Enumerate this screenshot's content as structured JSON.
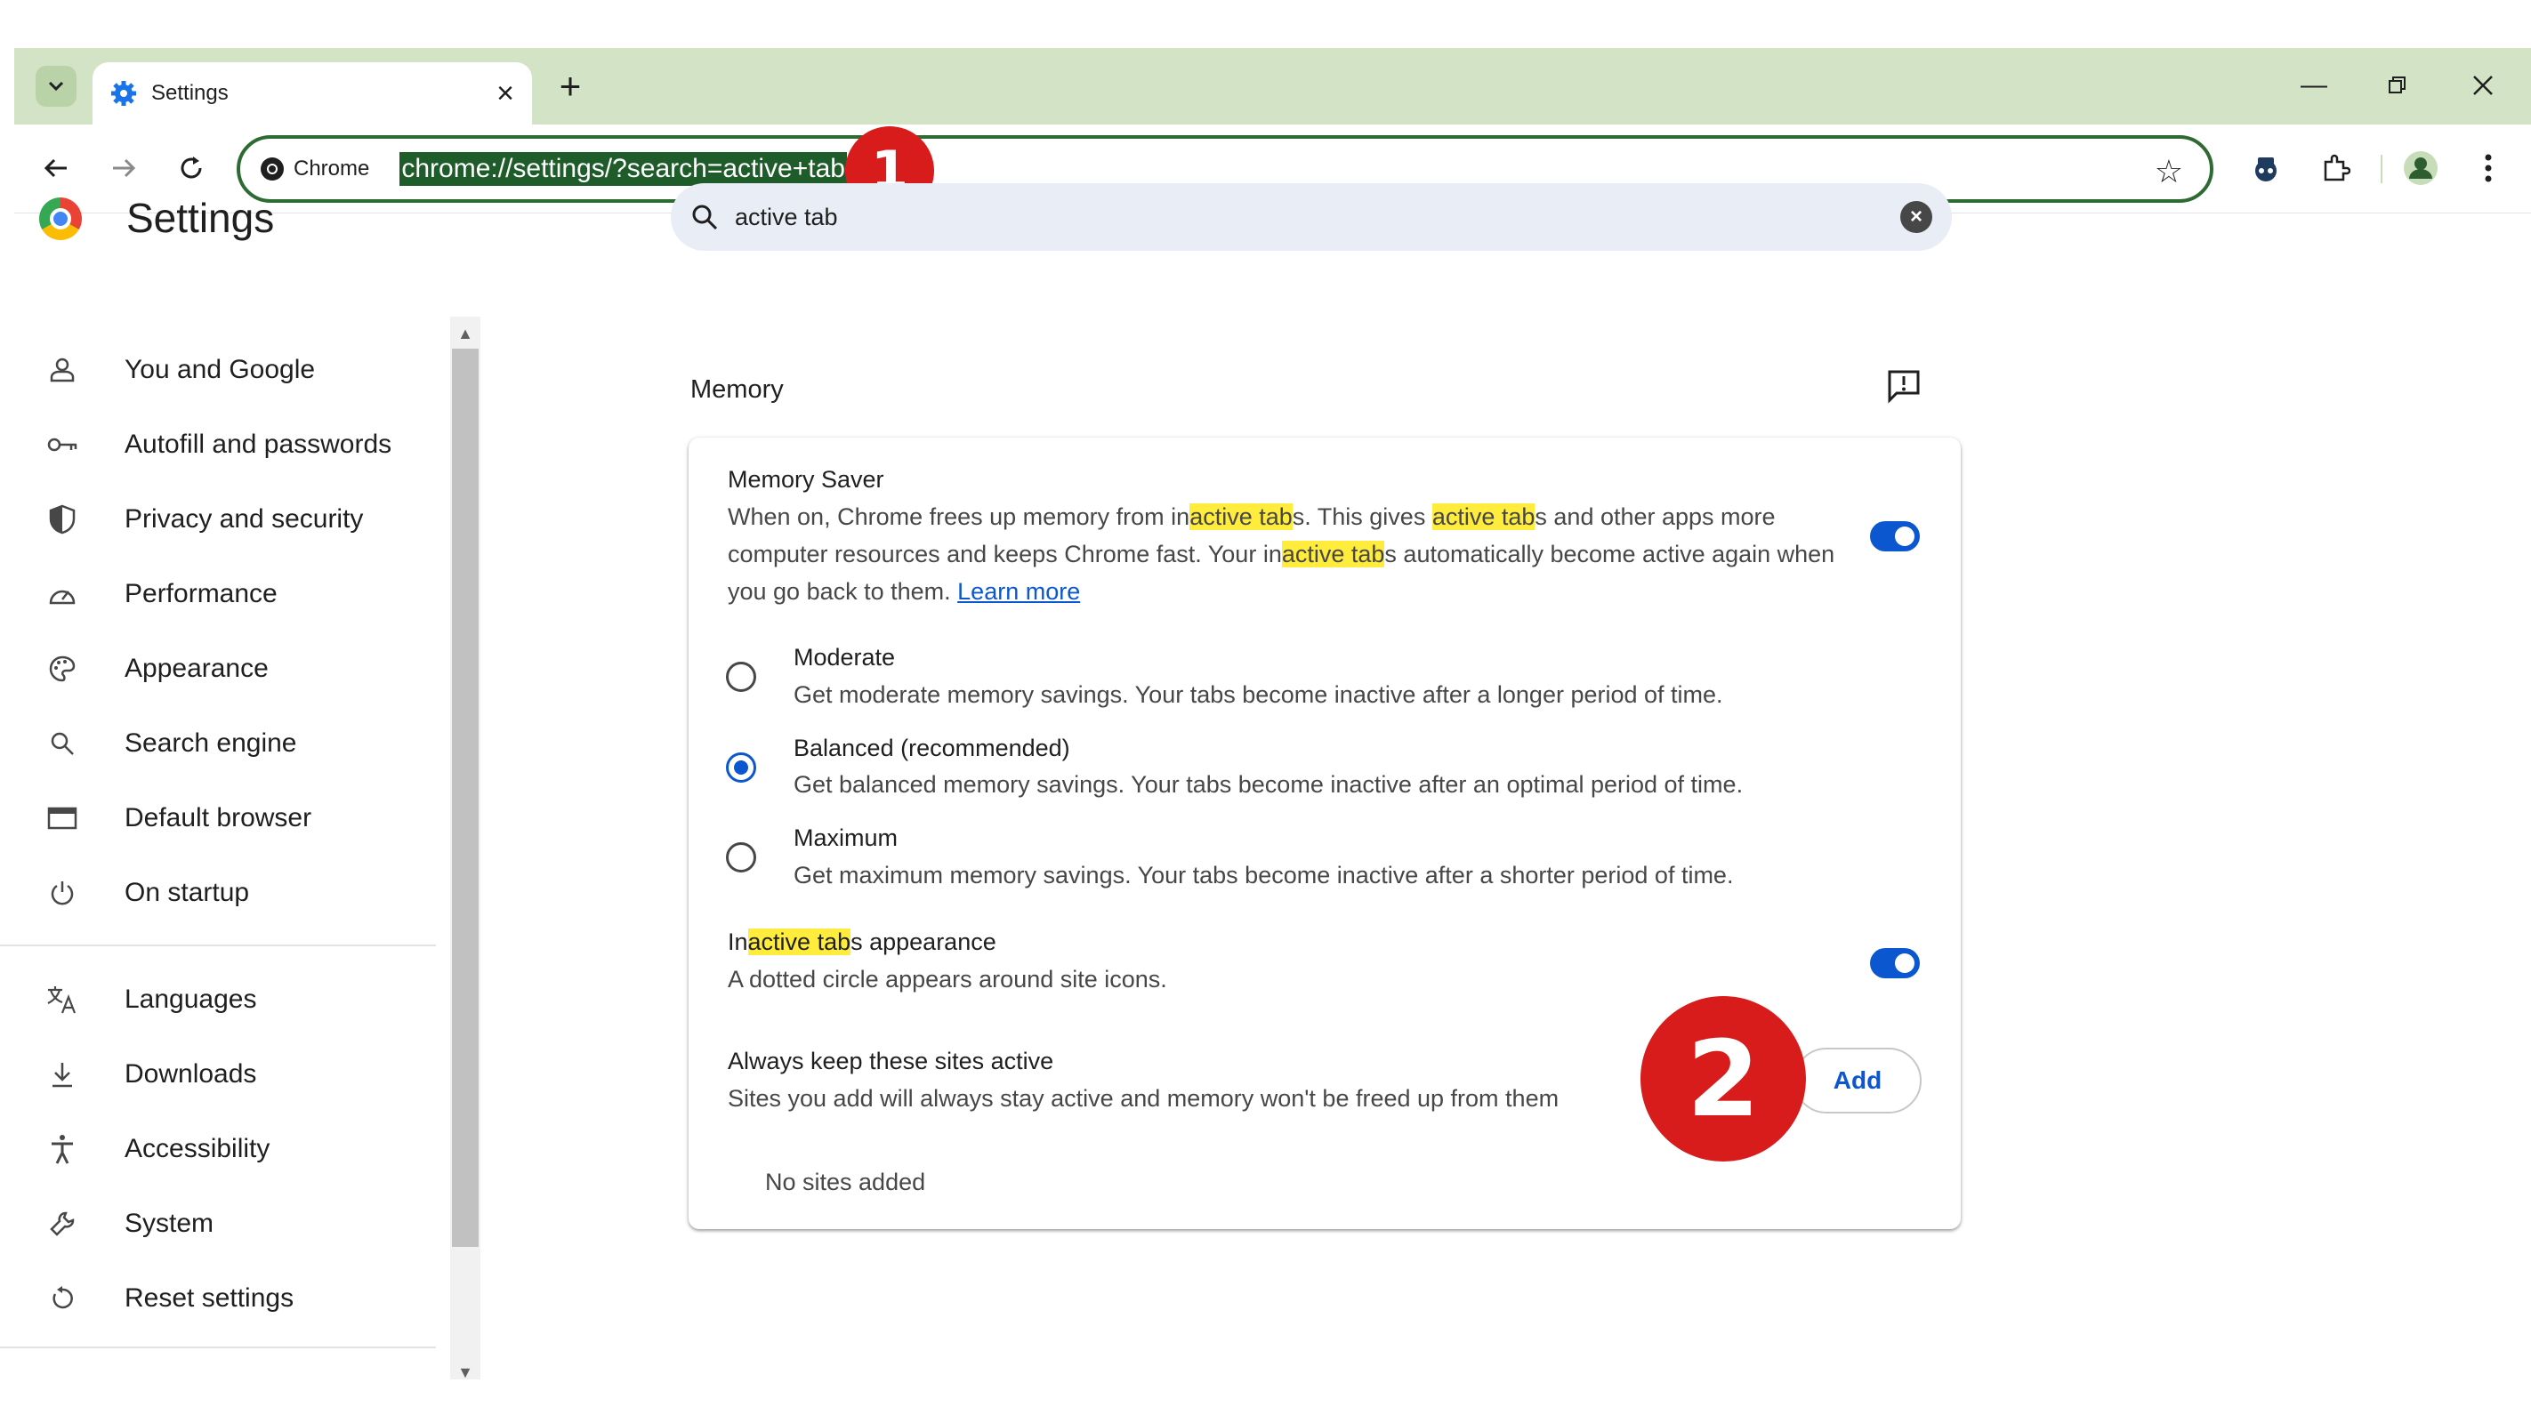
{
  "browser": {
    "tab_title": "Settings",
    "omnibox_chip": "Chrome",
    "url": "chrome://settings/?search=active+tab"
  },
  "annotations": {
    "badge1": "1",
    "badge2": "2"
  },
  "header": {
    "title": "Settings",
    "search_value": "active tab"
  },
  "sidebar": {
    "items": [
      {
        "label": "You and Google",
        "icon": "person-icon"
      },
      {
        "label": "Autofill and passwords",
        "icon": "key-icon"
      },
      {
        "label": "Privacy and security",
        "icon": "shield-icon"
      },
      {
        "label": "Performance",
        "icon": "speedometer-icon"
      },
      {
        "label": "Appearance",
        "icon": "palette-icon"
      },
      {
        "label": "Search engine",
        "icon": "search-icon"
      },
      {
        "label": "Default browser",
        "icon": "browser-window-icon"
      },
      {
        "label": "On startup",
        "icon": "power-icon"
      },
      {
        "label": "Languages",
        "icon": "translate-icon"
      },
      {
        "label": "Downloads",
        "icon": "download-icon"
      },
      {
        "label": "Accessibility",
        "icon": "accessibility-icon"
      },
      {
        "label": "System",
        "icon": "wrench-icon"
      },
      {
        "label": "Reset settings",
        "icon": "reset-icon"
      }
    ]
  },
  "main": {
    "section_title": "Memory",
    "memory_saver": {
      "title": "Memory Saver",
      "line1_a": "When on, Chrome frees up memory from in",
      "line1_hl1": "active tab",
      "line1_b": "s. This gives ",
      "line1_hl2": "active tab",
      "line1_c": "s and other apps more",
      "line2_a": "computer resources and keeps Chrome fast. Your in",
      "line2_hl": "active tab",
      "line2_b": "s automatically become active again when",
      "line3": "you go back to them. ",
      "learn_more": "Learn more",
      "enabled": true
    },
    "options": [
      {
        "label": "Moderate",
        "desc": "Get moderate memory savings. Your tabs become inactive after a longer period of time.",
        "selected": false
      },
      {
        "label": "Balanced (recommended)",
        "desc": "Get balanced memory savings. Your tabs become inactive after an optimal period of time.",
        "selected": true
      },
      {
        "label": "Maximum",
        "desc": "Get maximum memory savings. Your tabs become inactive after a shorter period of time.",
        "selected": false
      }
    ],
    "inactive_appearance": {
      "title_a": "In",
      "title_hl": "active tab",
      "title_b": "s appearance",
      "desc": "A dotted circle appears around site icons.",
      "enabled": true
    },
    "always_active": {
      "title": "Always keep these sites active",
      "desc": "Sites you add will always stay active and memory won't be freed up from them",
      "add_label": "Add",
      "empty": "No sites added"
    }
  },
  "colors": {
    "accent": "#0b57d0",
    "highlight": "#ffec3d",
    "badge": "#d81b1b",
    "frame": "#d3e3c6"
  }
}
